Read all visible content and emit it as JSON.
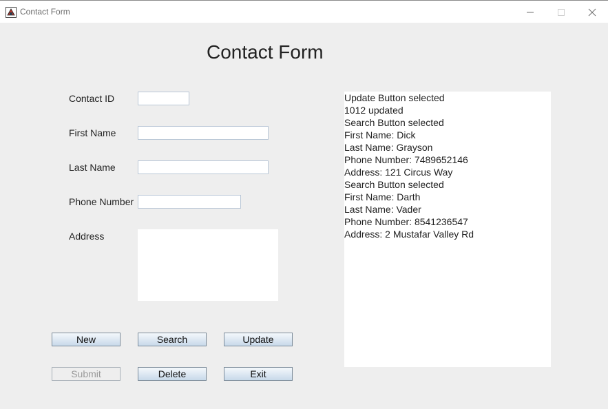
{
  "window": {
    "title": "Contact Form",
    "controls": {
      "minimize": "—",
      "maximize": "☐",
      "close": "✕"
    }
  },
  "form": {
    "heading": "Contact Form",
    "fields": {
      "contact_id": {
        "label": "Contact ID",
        "value": ""
      },
      "first_name": {
        "label": "First Name",
        "value": ""
      },
      "last_name": {
        "label": "Last Name",
        "value": ""
      },
      "phone": {
        "label": "Phone Number",
        "value": ""
      },
      "address": {
        "label": "Address",
        "value": ""
      }
    }
  },
  "buttons": {
    "new": "New",
    "search": "Search",
    "update": "Update",
    "submit": "Submit",
    "delete": "Delete",
    "exit": "Exit"
  },
  "log": {
    "lines": [
      "Update Button selected",
      "1012 updated",
      "Search Button selected",
      "First Name: Dick",
      "Last Name: Grayson",
      "Phone Number: 7489652146",
      "Address: 121 Circus Way",
      "Search Button selected",
      "First Name: Darth",
      "Last Name: Vader",
      "Phone Number: 8541236547",
      "Address: 2 Mustafar Valley Rd"
    ]
  },
  "colors": {
    "window_bg": "#eeeeee",
    "button_gradient_top": "#f4f8fc",
    "button_gradient_bottom": "#c8d9ea",
    "field_border": "#b8c6d6"
  }
}
